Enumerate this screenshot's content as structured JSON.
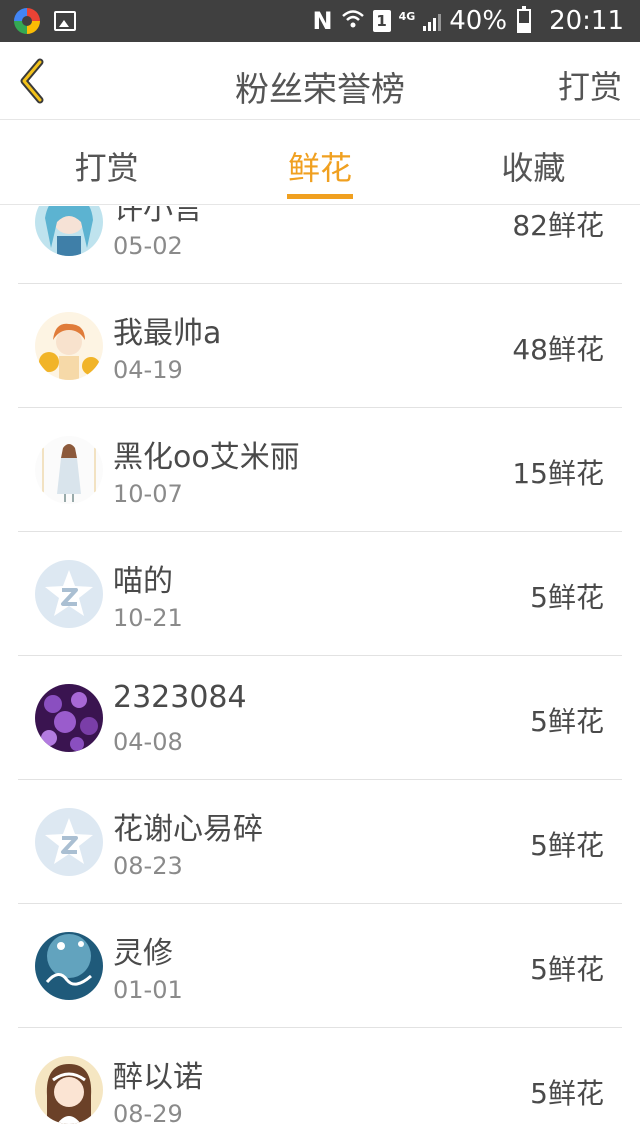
{
  "status_bar": {
    "battery": "40%",
    "time": "20:11",
    "network": "4G",
    "sim_label": "1",
    "nfc_label": "N"
  },
  "header": {
    "title": "粉丝荣誉榜",
    "right_action": "打赏"
  },
  "tabs": [
    {
      "label": "打赏",
      "active": false
    },
    {
      "label": "鲜花",
      "active": true
    },
    {
      "label": "收藏",
      "active": false
    }
  ],
  "fans": [
    {
      "name": "许小言",
      "date": "05-02",
      "amount": "82鲜花",
      "avatar": "anime-girl-blue-avatar"
    },
    {
      "name": "我最帅a",
      "date": "04-19",
      "amount": "48鲜花",
      "avatar": "sunflower-girl-avatar"
    },
    {
      "name": "黑化oo艾米丽",
      "date": "10-07",
      "amount": "15鲜花",
      "avatar": "standing-figure-avatar"
    },
    {
      "name": "喵的",
      "date": "10-21",
      "amount": "5鲜花",
      "avatar": "default-star-avatar"
    },
    {
      "name": "2323084",
      "date": "04-08",
      "amount": "5鲜花",
      "avatar": "purple-flowers-avatar"
    },
    {
      "name": "花谢心易碎",
      "date": "08-23",
      "amount": "5鲜花",
      "avatar": "default-star-avatar"
    },
    {
      "name": "灵修",
      "date": "01-01",
      "amount": "5鲜花",
      "avatar": "blue-calligraphy-avatar"
    },
    {
      "name": "醉以诺",
      "date": "08-29",
      "amount": "5鲜花",
      "avatar": "girl-headband-avatar"
    }
  ],
  "colors": {
    "accent": "#f0a020",
    "status_bar_bg": "#404040",
    "text_primary": "#4a4a4a",
    "text_secondary": "#8a8a8a"
  }
}
